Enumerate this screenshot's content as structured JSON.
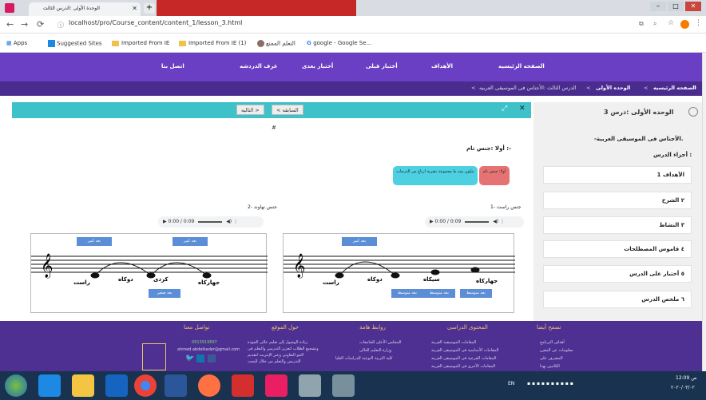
{
  "browser": {
    "tab_title": "الوحدة الأولى :الدرس الثالث",
    "url": "localhost/pro/Course_content/content_1/lesson_3.html",
    "bookmarks": [
      "Apps",
      "Suggested Sites",
      "Imported From IE",
      "Imported From IE (1)",
      "التعلم الممتع",
      "google - Google Se..."
    ]
  },
  "site_nav": {
    "items": [
      "الصفحه الرئيسيه",
      "الأهداف",
      "أختبار قبلى",
      "أختبار بعدى",
      "غرف الدردشه",
      "اتصل بنا"
    ]
  },
  "breadcrumb": {
    "home": "الصفحه الرئيسيه",
    "unit": "الوحده الأولى",
    "lesson": "الدرس الثالث :الأجناس فى الموسيقى العربيه"
  },
  "sidebar": {
    "title": "الوحده الأولى :درس 3",
    "subtitle": "-الأجناس فى الموسيقى العربية.",
    "parts_label": "أجزاء الدرس :",
    "items": [
      "1 الأهداف",
      "٢ الشرح",
      "٣ النشاط",
      "٤ قاموس المصطلحات",
      "٥ أختبار على الدرس",
      "٦ ملخص الدرس"
    ]
  },
  "lesson": {
    "prev_label": "< السابقه",
    "next_label": "التاليه >",
    "heading": "أولا :جنس تام :-",
    "def_label": "أولا: جنس تام",
    "def_text": "يتكون بينه ما مجموعة نشرية ارباع من الدرجات",
    "jins1_title": "1- جنس راست",
    "jins2_title": "2- جنس نهاوند",
    "audio_time": "0:00 / 0:09",
    "labels_left_top": [
      "بعد كبير",
      "بعد كبير"
    ],
    "labels_right_top": [
      "بعد كبير",
      "بعد كبير"
    ],
    "label_small": "بعد صغير",
    "labels_medium": [
      "بعد متوسط",
      "بعد متوسط",
      "بعد متوسط"
    ],
    "notes_left": [
      "جهاركاه",
      "كردى",
      "دوكاه",
      "راست"
    ],
    "notes_right": [
      "جهاركاه",
      "سيكاه",
      "دوكاه",
      "راست"
    ]
  },
  "footer": {
    "col1_title": "تصفح أيضا",
    "col2_title": "المحتوى الدراسى",
    "col3_title": "روابط هامة",
    "col4_title": "حول الموقع",
    "col5_title": "تواصل معنا",
    "col1_lines": [
      "أهداف البرنامج",
      "معلومات عن المقرر",
      "المشرف على",
      "الكاتبين بهذا"
    ],
    "col2_lines": [
      "المقامات الموسيقية العربية",
      "المقامات الأساسية فى الموسيقى العربية",
      "المقامات الفرعية فى الموسيقى العربية",
      "المقامات الأخرى فى الموسيقى العربية"
    ],
    "col3_lines": [
      "المجلس الأعلى للجامعات",
      "وزارة التعليم العالى",
      "كلية التربية النوعية للدراسات العليا"
    ],
    "col4_lines": [
      "زيادة الوصول إلى تعليم عالى الجودة",
      "وتشجيع الطلاب لتعزيز التدريس والتعلم فى",
      "الجو التعاونى وعبر الإنترنت لتقديم",
      "التدريس والتعلم من خلال البحث"
    ],
    "col5_lines": [
      "0913919897",
      "ahmed.abdelkader@gmail.com"
    ]
  },
  "taskbar": {
    "lang": "EN",
    "time": "12:09 ص",
    "date": "٢٠٢٠/٠٣/٠٢"
  },
  "colors": {
    "nav_purple": "#6a3fc3",
    "teal": "#3ec1c9",
    "footer": "#4e2f92"
  }
}
